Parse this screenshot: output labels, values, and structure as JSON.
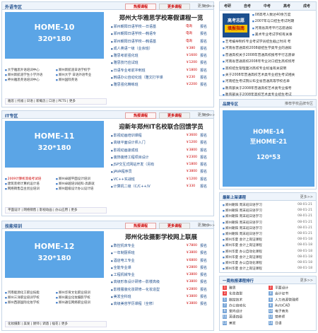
{
  "block1": {
    "title": "外语专区",
    "more": "更多>>",
    "photo_l1": "HOME-10",
    "photo_l2": "320*180",
    "links": [
      "大学雅思外语培训中心",
      "郑州新航道日语学校学",
      "郑州新航道学生小学外语",
      "郑州大学 日语外语专业",
      "神州雅思英语培训中心",
      "郑州国际英语"
    ],
    "tags": "雅思 | 托福 | 日语 | 新概念 | 口语 | PETS | 更多",
    "tab_hot": "热报课程",
    "tab_more": "更多课程",
    "bmore": "更多>>",
    "course_title": "郑州大华雅思学校寒假课程一览",
    "courses": [
      {
        "name": "郑州朝阳日语学校---日语基",
        "price": "电询",
        "sign": "报名"
      },
      {
        "name": "郑州朝阳日语学校---韩语专",
        "price": "电询",
        "sign": "报名"
      },
      {
        "name": "郑州朝阳日语学校---韩语基",
        "price": "电询",
        "sign": "报名"
      },
      {
        "name": "成人英语一级（业余班）",
        "price": "￥380",
        "sign": "报名"
      },
      {
        "name": "雅思考前强化班",
        "price": "￥1600",
        "sign": "报名"
      },
      {
        "name": "雅思技巧应试班",
        "price": "￥1200",
        "sign": "报名"
      },
      {
        "name": "日语专业考前冲刺班",
        "price": "￥1800",
        "sign": "报名"
      },
      {
        "name": "韩语办公自动化班（雅文打字课",
        "price": "￥230",
        "sign": "报名"
      },
      {
        "name": "雅思强化精练班",
        "price": "￥2200",
        "sign": "报名"
      }
    ]
  },
  "block2": {
    "title": "IT专区",
    "more": "更多>>",
    "photo_l1": "HOME-11",
    "photo_l2": "320*180",
    "links": [
      "2009计算机等级考试培",
      "郑州卓越平面设计培训",
      "建筑装修计算机设计培",
      "郑州卓越培训班科·高薪就",
      "网络销售自主创业培训",
      "郑州超级设计办公设计培"
    ],
    "tags": "平面设计 | 网络销售 | 影视动画 | 办公应用 | 更多",
    "tab_hot": "热报课程",
    "tab_more": "更多课程",
    "bmore": "更多>>",
    "course_title": "迎新年郑州IT名校联合回馈学员",
    "courses": [
      {
        "name": "影视动画培训课程",
        "price": "￥3600",
        "sign": "报名"
      },
      {
        "name": "高级平面设计师入门",
        "price": "￥1200",
        "sign": "报名"
      },
      {
        "name": "影视动画速成班",
        "price": "￥3800",
        "sign": "报名"
      },
      {
        "name": "装饰装修工程项目设计",
        "price": "￥2300",
        "sign": "报名"
      },
      {
        "name": "JSP交互式网站开发（另有",
        "price": "￥1800",
        "sign": "报名"
      },
      {
        "name": "JAVA程序员",
        "price": "￥3800",
        "sign": "报名"
      },
      {
        "name": "VC++实战班",
        "price": "￥1200",
        "sign": "报名"
      },
      {
        "name": "计算机二级（C/C++/V",
        "price": "￥330",
        "sign": "报名"
      }
    ]
  },
  "block3": {
    "title": "技能培训",
    "more": "更多>>",
    "photo_l1": "HOME-12",
    "photo_l2": "320*180",
    "links": [
      "河南能源化工职业技能",
      "郑州华育文化职业培训",
      "郑州三洋职业培训学校",
      "郑州嘉业化妆摄影学校",
      "郑州西部国际化妆学校",
      "郑州通信网络职业培训"
    ],
    "tags": "化妆摄影 | 美发 | 厨师 | 调酒 | 插花 | 更多",
    "tab_hot": "热报课程",
    "tab_more": "更多课程",
    "bmore": "更多>>",
    "course_title": "郑州化妆摄影学校网上联展",
    "courses": [
      {
        "name": "数控机床专业",
        "price": "￥7800",
        "sign": "报名"
      },
      {
        "name": "一年制厨师班",
        "price": "￥3800",
        "sign": "报名"
      },
      {
        "name": "酒店电工专业",
        "price": "￥6800",
        "sign": "报名"
      },
      {
        "name": "全能专业课",
        "price": "￥2800",
        "sign": "报名"
      },
      {
        "name": "工程机械专业",
        "price": "￥3800",
        "sign": "报名"
      },
      {
        "name": "高级形象设计研修---影楼高级",
        "price": "￥3800",
        "sign": "报名"
      },
      {
        "name": "影楼服装化妆研修---化妆造型",
        "price": "￥2800",
        "sign": "报名"
      },
      {
        "name": "美发全科班",
        "price": "￥3800",
        "sign": "报名"
      },
      {
        "name": "高级美容学历课程（全修）",
        "price": "￥3800",
        "sign": "报名"
      }
    ]
  },
  "news": {
    "tabs": [
      "考研",
      "自考",
      "中考",
      "高考",
      "成考"
    ],
    "banner_l1": "高考志愿",
    "banner_l2": "填报指南",
    "top_items": [
      "08高考人数达40余万度",
      "2007年与口招生考试时期",
      "河南省高考平行志愿通知",
      "美术专业考试学校有关事"
    ],
    "items": [
      "艺考编导制作专业考试学员招生截止时间 考",
      "河南省普通高校2008级招生学类专业的通知",
      "普通高校关于2008年普通高校报考平行志愿录",
      "河南省普通高校2008年专业对口招生高校统考",
      "高校招生管理面对高校专业标准有关说明",
      "关于2008年普通高校艺术类专业招生考试相关",
      "河南招生考试院公布全省普通高等学校名单",
      "教育部关于2008年普通高校艺术类专业报考",
      "教育部关于2008年高校艺术类专业招生考试"
    ]
  },
  "brand": {
    "title": "品牌专区",
    "more": "推荐学校品牌专区",
    "l1": "HOME-14",
    "l2": "至HOME-21",
    "l3": "120*53"
  },
  "latest": {
    "title": "最新上架课程",
    "more": "更多>>",
    "items": [
      {
        "school": "郑州朝阳",
        "course": "周末班日语学习",
        "date": "08-01-21"
      },
      {
        "school": "郑州朝阳",
        "course": "周末班日语学习",
        "date": "08-01-21"
      },
      {
        "school": "郑州朝阳",
        "course": "周末班日语学习",
        "date": "08-01-21"
      },
      {
        "school": "郑州朝阳",
        "course": "周末班日语学习",
        "date": "08-01-21"
      },
      {
        "school": "郑州朝阳",
        "course": "周末班日语学习",
        "date": "08-01-21"
      },
      {
        "school": "郑州朝阳",
        "course": "周末班日语学习",
        "date": "08-01-21"
      },
      {
        "school": "郑州华夏",
        "course": "会计上岗证课程",
        "date": "08-01-18"
      },
      {
        "school": "郑州华夏",
        "course": "会计上岗证课程",
        "date": "08-01-18"
      },
      {
        "school": "郑州华夏",
        "course": "办公自动化课程",
        "date": "08-01-18"
      },
      {
        "school": "郑州华夏",
        "course": "会计上岗证课程",
        "date": "08-01-18"
      },
      {
        "school": "郑州华夏",
        "course": "办公自动化课程",
        "date": "08-01-18"
      },
      {
        "school": "郑州华夏",
        "course": "会计上岗证课程",
        "date": "08-01-18"
      },
      {
        "school": "郑州华夏",
        "course": "办公自动化课程",
        "date": "08-01-18"
      },
      {
        "school": "郑州华夏",
        "course": "会计上岗证课程",
        "date": "08-01-18"
      }
    ]
  },
  "rank": {
    "title": "一周热报课程排行",
    "more": "更多>>",
    "items": [
      {
        "n": "1",
        "name": "雅思"
      },
      {
        "n": "2",
        "name": "平面设计"
      },
      {
        "n": "3",
        "name": "化妆造型"
      },
      {
        "n": "4",
        "name": "会计证书"
      },
      {
        "n": "5",
        "name": "数控技术"
      },
      {
        "n": "6",
        "name": "人力资源管理师"
      },
      {
        "n": "7",
        "name": "办公自动化"
      },
      {
        "n": "8",
        "name": "AutoCAD"
      },
      {
        "n": "9",
        "name": "室内设计"
      },
      {
        "n": "10",
        "name": "电子商务"
      },
      {
        "n": "11",
        "name": "英语四级"
      },
      {
        "n": "12",
        "name": "营养师"
      },
      {
        "n": "13",
        "name": "美发"
      },
      {
        "n": "14",
        "name": "日语"
      }
    ]
  }
}
